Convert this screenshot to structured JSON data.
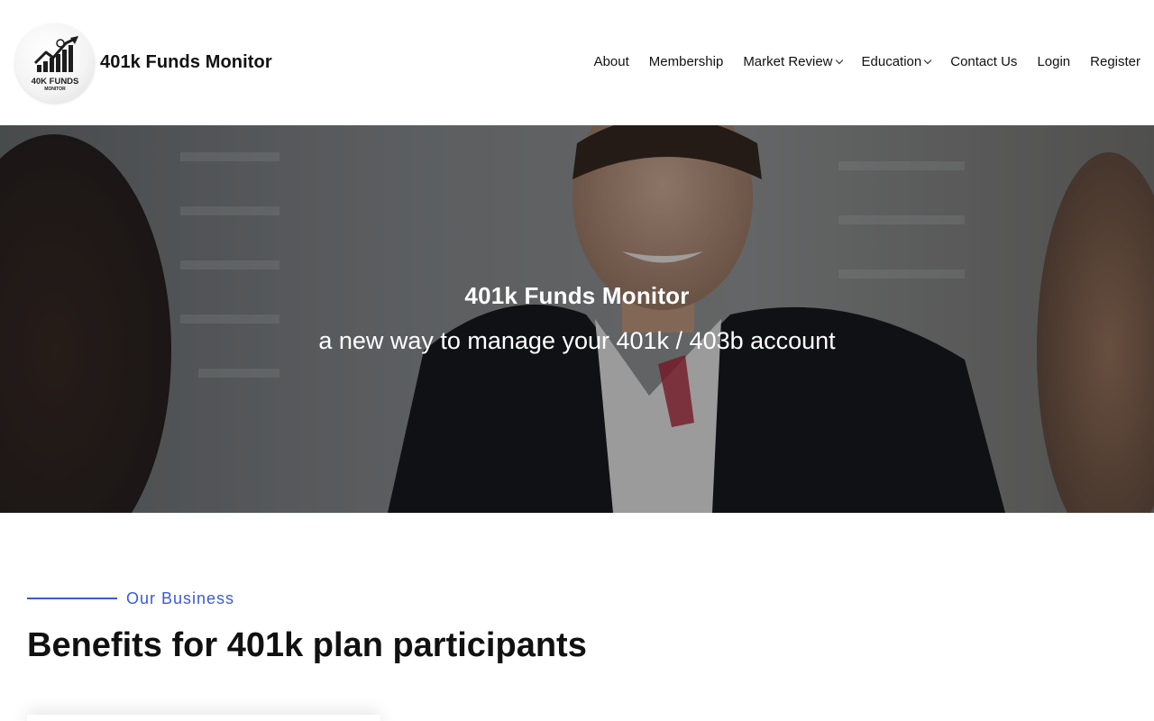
{
  "logo": {
    "icon": "chart-arrow-logo-icon",
    "line1": "40K FUNDS",
    "line2": "MONITOR"
  },
  "site": {
    "title": "401k Funds Monitor"
  },
  "nav": {
    "items": [
      {
        "label": "About",
        "dropdown": false
      },
      {
        "label": "Membership",
        "dropdown": false
      },
      {
        "label": "Market Review",
        "dropdown": true
      },
      {
        "label": "Education",
        "dropdown": true
      },
      {
        "label": "Contact Us",
        "dropdown": false
      },
      {
        "label": "Login",
        "dropdown": false
      },
      {
        "label": "Register",
        "dropdown": false
      }
    ]
  },
  "hero": {
    "title": "401k Funds Monitor",
    "subtitle": "a new way to manage your 401k / 403b account"
  },
  "business": {
    "eyebrow": "Our Business",
    "title": "Benefits for 401k plan participants"
  },
  "colors": {
    "accent": "#3a5bd9",
    "text": "#111111",
    "hero_overlay": "rgba(0,0,0,0.35)"
  }
}
